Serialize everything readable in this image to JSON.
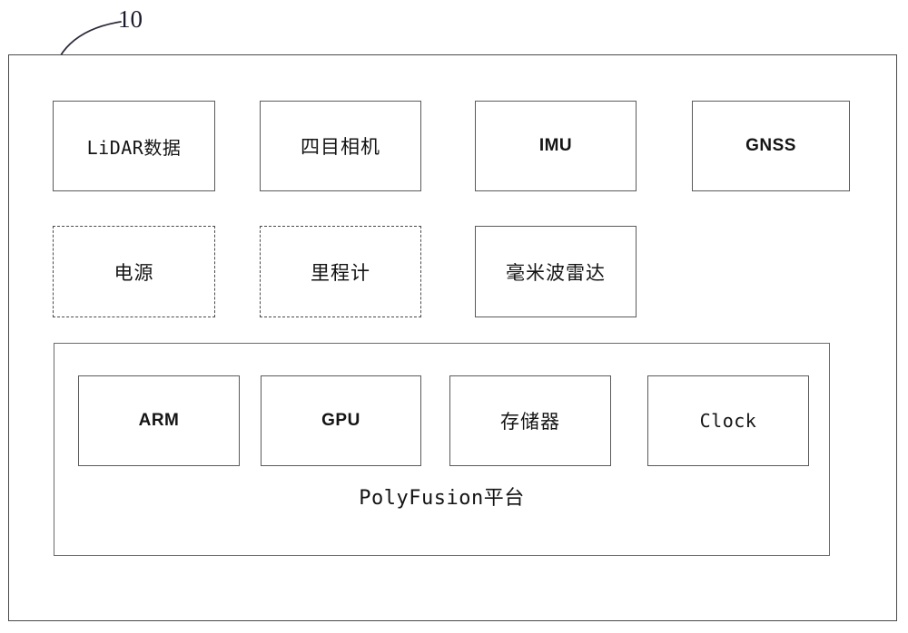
{
  "figure": {
    "reference_numeral": "10"
  },
  "sensor_row": [
    {
      "label": "LiDAR数据",
      "style": "solid",
      "text_style": "mono-cjk"
    },
    {
      "label": "四目相机",
      "style": "solid",
      "text_style": "cjk"
    },
    {
      "label": "IMU",
      "style": "solid",
      "text_style": "bold"
    },
    {
      "label": "GNSS",
      "style": "solid",
      "text_style": "bold"
    }
  ],
  "auxiliary_row": [
    {
      "label": "电源",
      "style": "dashed",
      "text_style": "cjk"
    },
    {
      "label": "里程计",
      "style": "dashed",
      "text_style": "cjk"
    },
    {
      "label": "毫米波雷达",
      "style": "solid",
      "text_style": "cjk"
    }
  ],
  "platform": {
    "title": "PolyFusion平台",
    "components": [
      {
        "label": "ARM",
        "text_style": "bold"
      },
      {
        "label": "GPU",
        "text_style": "bold"
      },
      {
        "label": "存储器",
        "text_style": "cjk"
      },
      {
        "label": "Clock",
        "text_style": "mono"
      }
    ]
  },
  "colors": {
    "stroke": "#4a4a4a",
    "box_stroke": "#5a5a5a",
    "text": "#141414",
    "background": "#ffffff"
  }
}
